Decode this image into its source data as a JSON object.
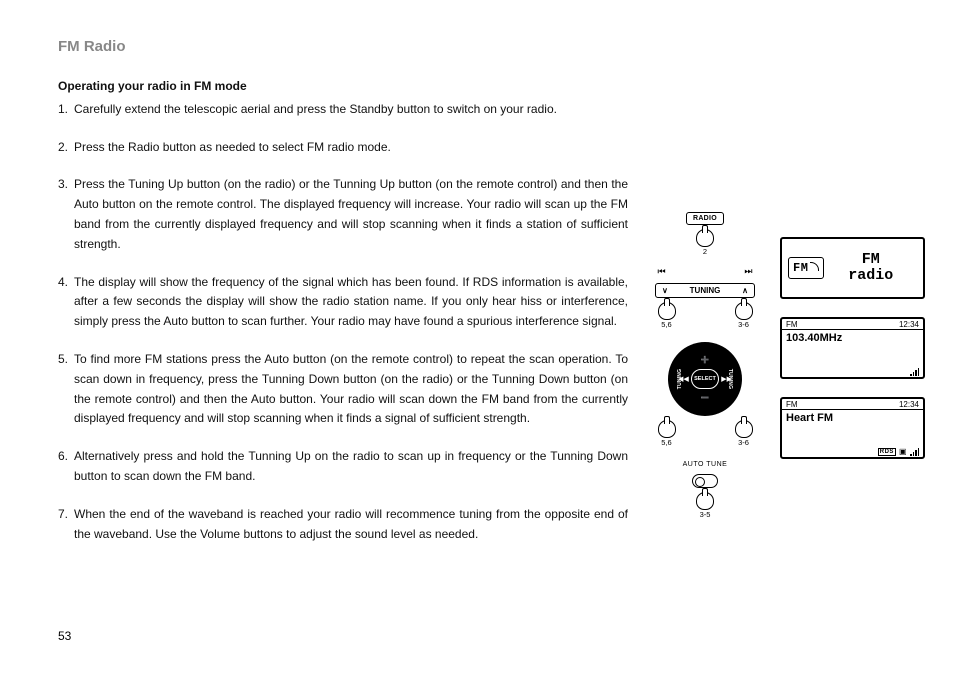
{
  "page_number": "53",
  "title": "FM Radio",
  "subheading": "Operating your radio in FM mode",
  "steps": [
    {
      "n": "1.",
      "t": "Carefully extend the telescopic aerial and press the Standby button to switch on your radio."
    },
    {
      "n": "2.",
      "t": "Press the Radio button as needed to select FM radio mode."
    },
    {
      "n": "3.",
      "t": "Press the Tuning Up button (on the radio) or the Tunning Up button (on the remote control) and then the Auto button on the remote control. The displayed frequency will increase. Your radio will scan up the FM band from the currently displayed frequency and will stop scanning when it finds a station of sufficient strength."
    },
    {
      "n": "4.",
      "t": "The display will show the frequency of the signal which has been found. If RDS information is available, after a few seconds the display will show the radio station name. If you only hear hiss or interference, simply press the Auto button to scan further. Your radio may have found a spurious interference signal."
    },
    {
      "n": "5.",
      "t": "To find more FM stations press the Auto button (on the remote control) to repeat the scan operation. To scan down in frequency, press the Tunning Down button (on the radio) or the Tunning Down button (on the remote control) and then the Auto button. Your radio will scan down the FM band from the currently displayed frequency and will stop scanning when it finds a signal of sufficient strength."
    },
    {
      "n": "6.",
      "t": "Alternatively press and hold the Tunning Up on the radio to scan up in frequency or the Tunning Down button to scan down the FM band."
    },
    {
      "n": "7.",
      "t": "When the end of the waveband is reached your radio will recommence tuning from the opposite end of the waveband. Use the Volume buttons to adjust the sound level as needed."
    }
  ],
  "controls": {
    "radio_btn": "RADIO",
    "radio_hand": "2",
    "skip_prev": "⏮",
    "skip_next": "⏭",
    "tuning_label": "TUNING",
    "tuning_down": "∨",
    "tuning_up": "∧",
    "tuning_hand_left": "5,6",
    "tuning_hand_right": "3-6",
    "dpad": {
      "select": "SELECT",
      "up": "➕",
      "down": "➖",
      "left": "◀◀",
      "right": "▶▶",
      "lbl_left": "TUNING",
      "lbl_right": "TUNING",
      "hand_left": "5,6",
      "hand_right": "3-6"
    },
    "auto_tune_label": "AUTO TUNE",
    "auto_tune_hand": "3-5"
  },
  "screens": {
    "mode": {
      "icon": "FM",
      "line1": "FM",
      "line2": "radio"
    },
    "freq": {
      "band": "FM",
      "clock": "12:34",
      "main": "103.40MHz"
    },
    "rds": {
      "band": "FM",
      "clock": "12:34",
      "main": "Heart FM",
      "rds_badge": "RDS"
    }
  }
}
